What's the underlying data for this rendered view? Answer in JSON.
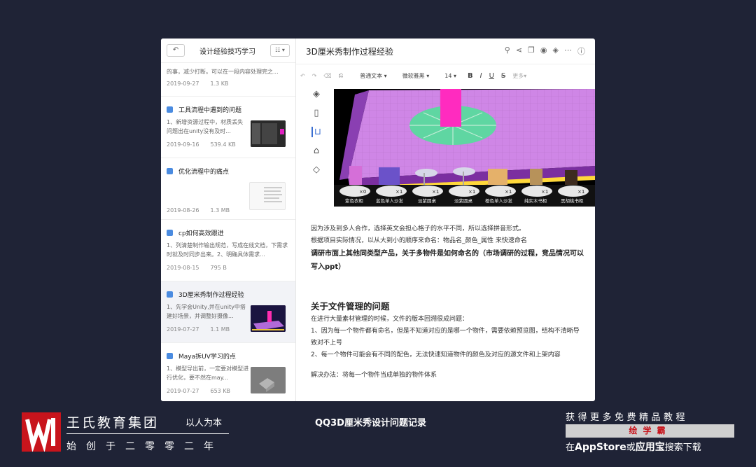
{
  "sidebar": {
    "title": "设计经验技巧学习",
    "back_icon": "undo-arrow-icon",
    "view_label": "☷ ▾",
    "notes": [
      {
        "title": "",
        "snippet": "的事，减少打断。可以在一段内容处理完之...",
        "date": "2019-09-27",
        "size": "1.3 KB"
      },
      {
        "title": "工具流程中遇到的问题",
        "snippet": "1、新增资源过程中，材质丢失 问题出在unity没有及时...",
        "date": "2019-09-16",
        "size": "539.4 KB"
      },
      {
        "title": "优化流程中的痛点",
        "snippet": "",
        "date": "2019-08-26",
        "size": "1.3 MB"
      },
      {
        "title": "cp如何高效跟进",
        "snippet": "1、列清楚制作输出规范，写成在线文档，下需求时就及时同步出来。2、明确具体需求...",
        "date": "2019-08-15",
        "size": "795 B"
      },
      {
        "title": "3D厘米秀制作过程经验",
        "snippet": "1、先学会Unity,并在unity中搭建好场景，并调整好摄像...",
        "date": "2019-07-27",
        "size": "1.1 MB"
      },
      {
        "title": "Maya拆UV学习的点",
        "snippet": "1、模型导出前，一定要对模型进行优化，要不然在may...",
        "date": "2019-07-27",
        "size": "653 KB"
      }
    ]
  },
  "main": {
    "title": "3D厘米秀制作过程经验",
    "header_icons": [
      "search-icon",
      "share-icon",
      "copy-icon",
      "play-icon",
      "tag-icon",
      "more-icon",
      "info-icon"
    ],
    "toolbar": {
      "undo": "↶",
      "redo": "↷",
      "clear": "⌫",
      "format_paint": "⎌",
      "style": "普通文本 ▾",
      "font": "微软雅黑 ▾",
      "size": "14 ▾",
      "bold": "B",
      "italic": "I",
      "underline": "U",
      "strike": "S",
      "more": "更多▾"
    },
    "scene_items": [
      {
        "label": "紫色衣柜",
        "count": "×0"
      },
      {
        "label": "蓝色单人沙发",
        "count": "×1"
      },
      {
        "label": "淡紫圆桌",
        "count": "×1"
      },
      {
        "label": "淡紫圆桌",
        "count": "×1"
      },
      {
        "label": "橙色单人沙发",
        "count": "×1"
      },
      {
        "label": "纯实木书柜",
        "count": "×1"
      },
      {
        "label": "黑胡桃书柜",
        "count": "×1"
      }
    ],
    "content": {
      "p1": "因为涉及到多人合作，选择英文会担心格子的水平不同，所以选择拼音形式。",
      "p2": "根据项目实际情况，以从大到小的顺序来命名：物品名_颜色_属性 来快速命名",
      "p3": "调研市面上其他同类型产品，关于多物件是如何命名的（市场调研的过程，竞品情况可以写入ppt）",
      "h2": "关于文件管理的问题",
      "p4": "在进行大量素材管理的时候，文件的版本回溯很成问题：",
      "p5": "1、因为每一个物件都有命名，但是不知道对应的是哪一个物件，需要依赖预览图，结构不清晰导致对不上号",
      "p6": "2、每一个物件可能会有不同的配色，无法快速知道物件的颜色及对应的源文件和上架内容",
      "p7": "解决办法：将每一个物件当成单独的物件体系"
    }
  },
  "footer": {
    "brand": "王氏教育集团",
    "tagline": "以人为本",
    "since": "始创于二零零二年",
    "caption": "QQ3D厘米秀设计问题记录",
    "promo1": "获得更多免费精品教程",
    "promo2": "绘学霸",
    "promo3_a": "在",
    "promo3_b": "AppStore",
    "promo3_c": "或",
    "promo3_d": "应用宝",
    "promo3_e": "搜索下载"
  },
  "colors": {
    "background": "#1f2336",
    "accent": "#3b6fd1",
    "logo_red": "#c8141c"
  }
}
